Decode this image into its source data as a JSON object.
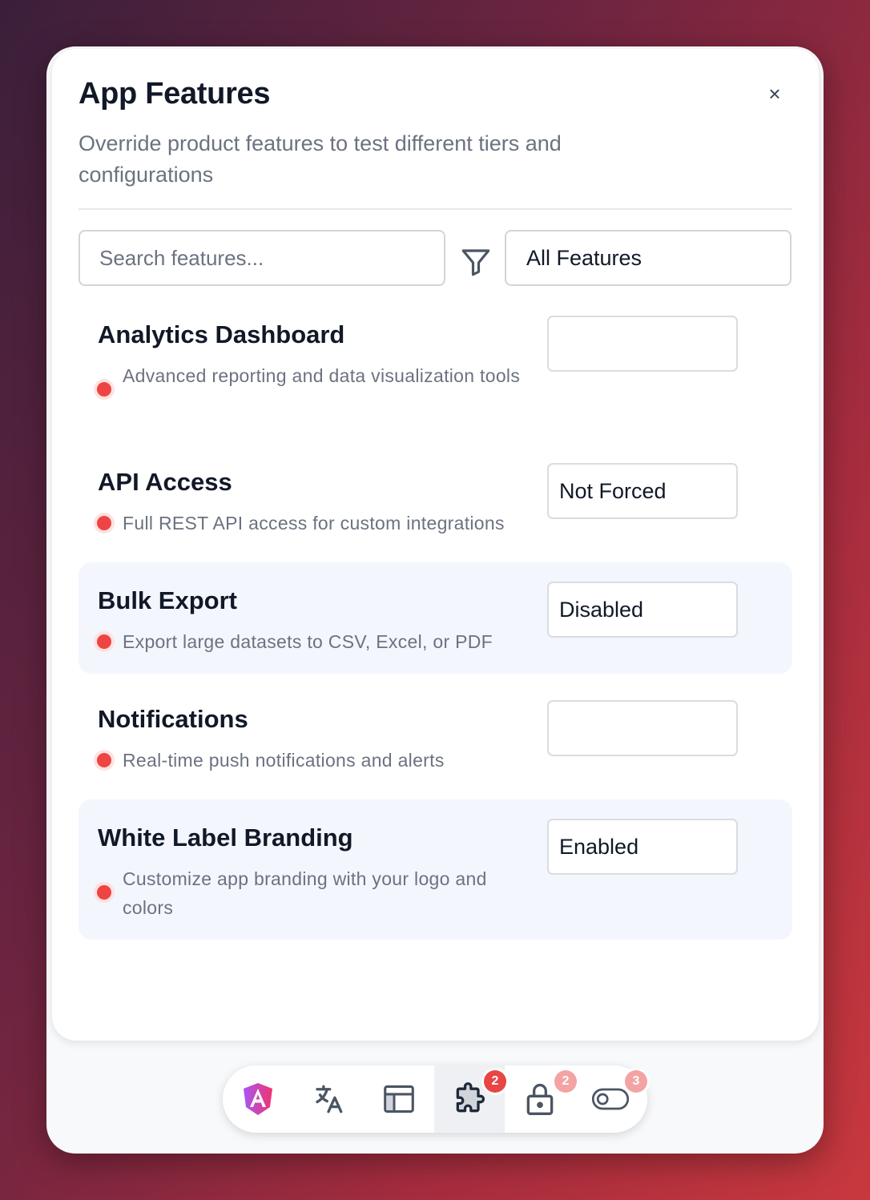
{
  "panel": {
    "title": "App Features",
    "subtitle": "Override product features to test different tiers and configurations",
    "close_label": "×"
  },
  "toolbar": {
    "search_placeholder": "Search features...",
    "filter_value": "All Features"
  },
  "features": [
    {
      "name": "Analytics Dashboard",
      "description": "Advanced reporting and data visualization tools",
      "override": "",
      "status_color": "#ef4444"
    },
    {
      "name": "API Access",
      "description": "Full REST API access for custom integrations",
      "override": "Not Forced",
      "status_color": "#ef4444"
    },
    {
      "name": "Bulk Export",
      "description": "Export large datasets to CSV, Excel, or PDF",
      "override": "Disabled",
      "status_color": "#ef4444"
    },
    {
      "name": "Notifications",
      "description": "Real-time push notifications and alerts",
      "override": "",
      "status_color": "#ef4444"
    },
    {
      "name": "White Label Branding",
      "description": "Customize app branding with your logo and colors",
      "override": "Enabled",
      "status_color": "#ef4444"
    }
  ],
  "dock": {
    "items": [
      {
        "icon": "angular-logo-icon"
      },
      {
        "icon": "translate-icon"
      },
      {
        "icon": "layout-icon"
      },
      {
        "icon": "puzzle-icon",
        "badge": "2",
        "active": true
      },
      {
        "icon": "lock-icon",
        "badge": "2"
      },
      {
        "icon": "toggle-icon",
        "badge": "3"
      }
    ]
  }
}
